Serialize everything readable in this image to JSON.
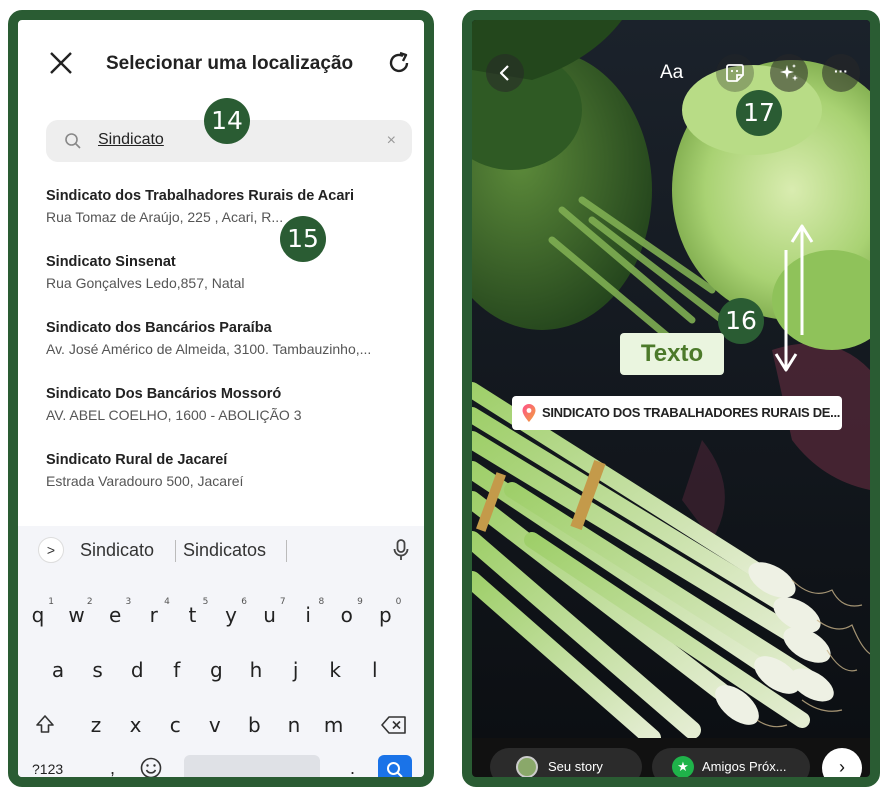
{
  "left": {
    "header": {
      "title": "Selecionar uma localização"
    },
    "search": {
      "value": "Sindicato",
      "clear": "×"
    },
    "badge_14": "14",
    "badge_15": "15",
    "results": [
      {
        "name": "Sindicato dos Trabalhadores Rurais de Acari",
        "address": "Rua Tomaz de Araújo, 225 , Acari, R..."
      },
      {
        "name": "Sindicato Sinsenat",
        "address": "Rua Gonçalves Ledo,857, Natal"
      },
      {
        "name": "Sindicato dos Bancários Paraíba",
        "address": "Av. José Américo de Almeida, 3100. Tambauzinho,..."
      },
      {
        "name": "Sindicato Dos Bancários Mossoró",
        "address": "AV. ABEL COELHO, 1600 - ABOLIÇÃO 3"
      },
      {
        "name": "Sindicato Rural de Jacareí",
        "address": "Estrada Varadouro 500, Jacareí"
      }
    ],
    "keyboard": {
      "expand": ">",
      "suggestions": [
        "Sindicato",
        "Sindicatos"
      ],
      "row1": [
        "q",
        "w",
        "e",
        "r",
        "t",
        "y",
        "u",
        "i",
        "o",
        "p"
      ],
      "row1_hints": [
        "1",
        "2",
        "3",
        "4",
        "5",
        "6",
        "7",
        "8",
        "9",
        "0"
      ],
      "row2": [
        "a",
        "s",
        "d",
        "f",
        "g",
        "h",
        "j",
        "k",
        "l"
      ],
      "row3": [
        "z",
        "x",
        "c",
        "v",
        "b",
        "n",
        "m"
      ],
      "symbols_key": "?123",
      "comma": ",",
      "period": "."
    }
  },
  "right": {
    "aa": "Aa",
    "more": "···",
    "badge_16": "16",
    "badge_17": "17",
    "texto_sticker": "Texto",
    "location_sticker": "SINDICATO DOS TRABALHADORES RURAIS DE...",
    "story_bar": {
      "your_story": "Seu story",
      "close_friends": "Amigos Próx...",
      "next": "›"
    }
  },
  "colors": {
    "frame": "#2a5c33",
    "accent_blue": "#1a73e8",
    "sticker_green": "#4c7a2a"
  }
}
